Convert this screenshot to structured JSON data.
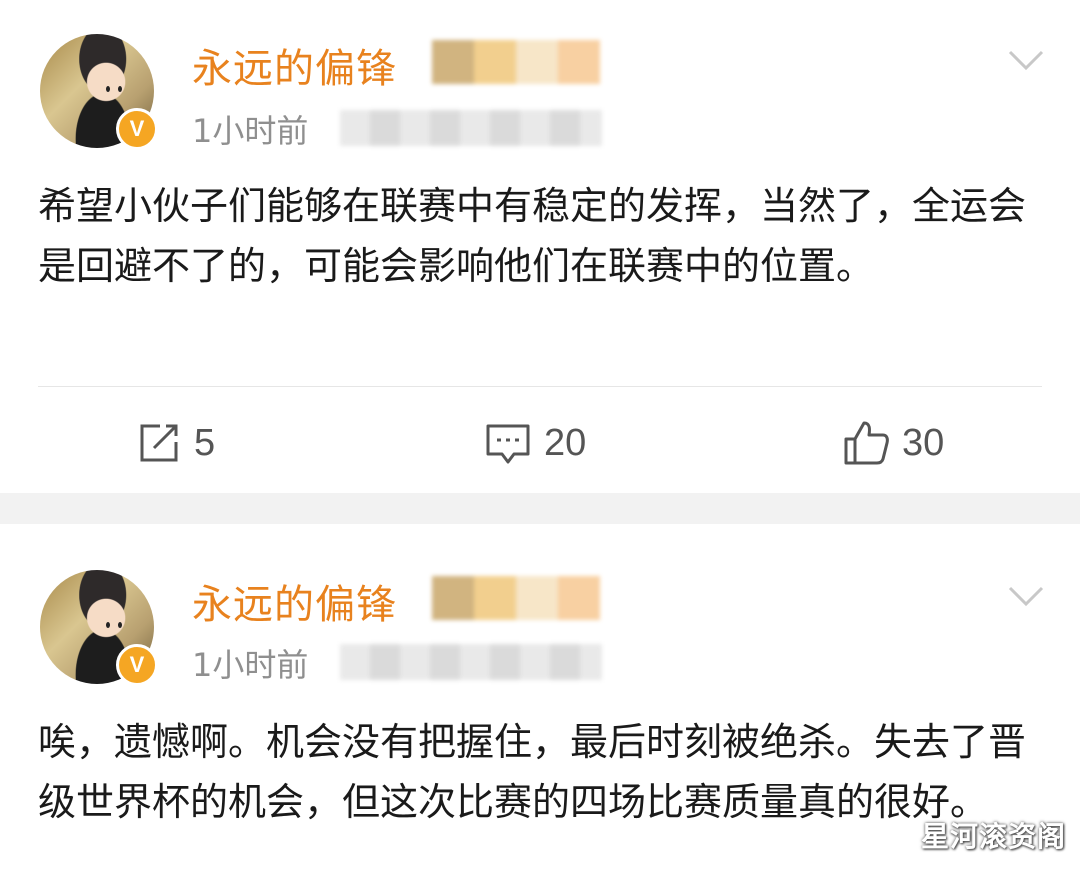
{
  "posts": [
    {
      "username": "永远的偏锋",
      "time": "1小时前",
      "content": "希望小伙子们能够在联赛中有稳定的发挥，当然了，全运会是回避不了的，可能会影响他们在联赛中的位置。",
      "repost_count": "5",
      "comment_count": "20",
      "like_count": "30",
      "badge": "V"
    },
    {
      "username": "永远的偏锋",
      "time": "1小时前",
      "content": "唉，遗憾啊。机会没有把握住，最后时刻被绝杀。失去了晋级世界杯的机会，但这次比赛的四场比赛质量真的很好。",
      "badge": "V"
    }
  ],
  "watermark": "星河滚资阁",
  "colors": {
    "username": "#e8821e",
    "badge": "#f5a623",
    "separator": "#f2f2f2"
  }
}
